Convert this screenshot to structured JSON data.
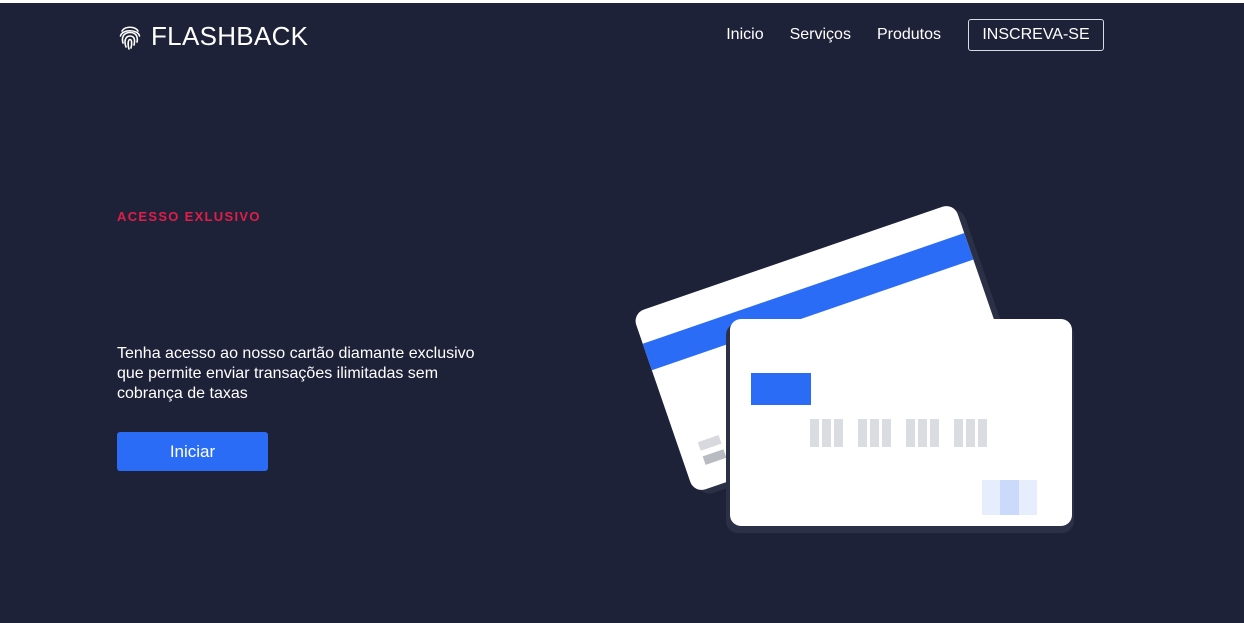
{
  "brand": {
    "name": "FLASHBACK",
    "logo_icon": "fingerprint-icon"
  },
  "nav": {
    "links": [
      "Inicio",
      "Serviços",
      "Produtos"
    ],
    "cta_label": "INSCREVA-SE"
  },
  "hero": {
    "eyebrow": "ACESSO EXLUSIVO",
    "description": "Tenha acesso ao nosso cartão diamante exclusivo que permite enviar transações ilimitadas sem cobrança de taxas",
    "button_label": "Iniciar"
  },
  "colors": {
    "background": "#1e2239",
    "accent": "#2b6cf6",
    "eyebrow": "#e11d48",
    "card": "#ffffff"
  },
  "illustration": {
    "icon": "credit-cards-illustration"
  }
}
